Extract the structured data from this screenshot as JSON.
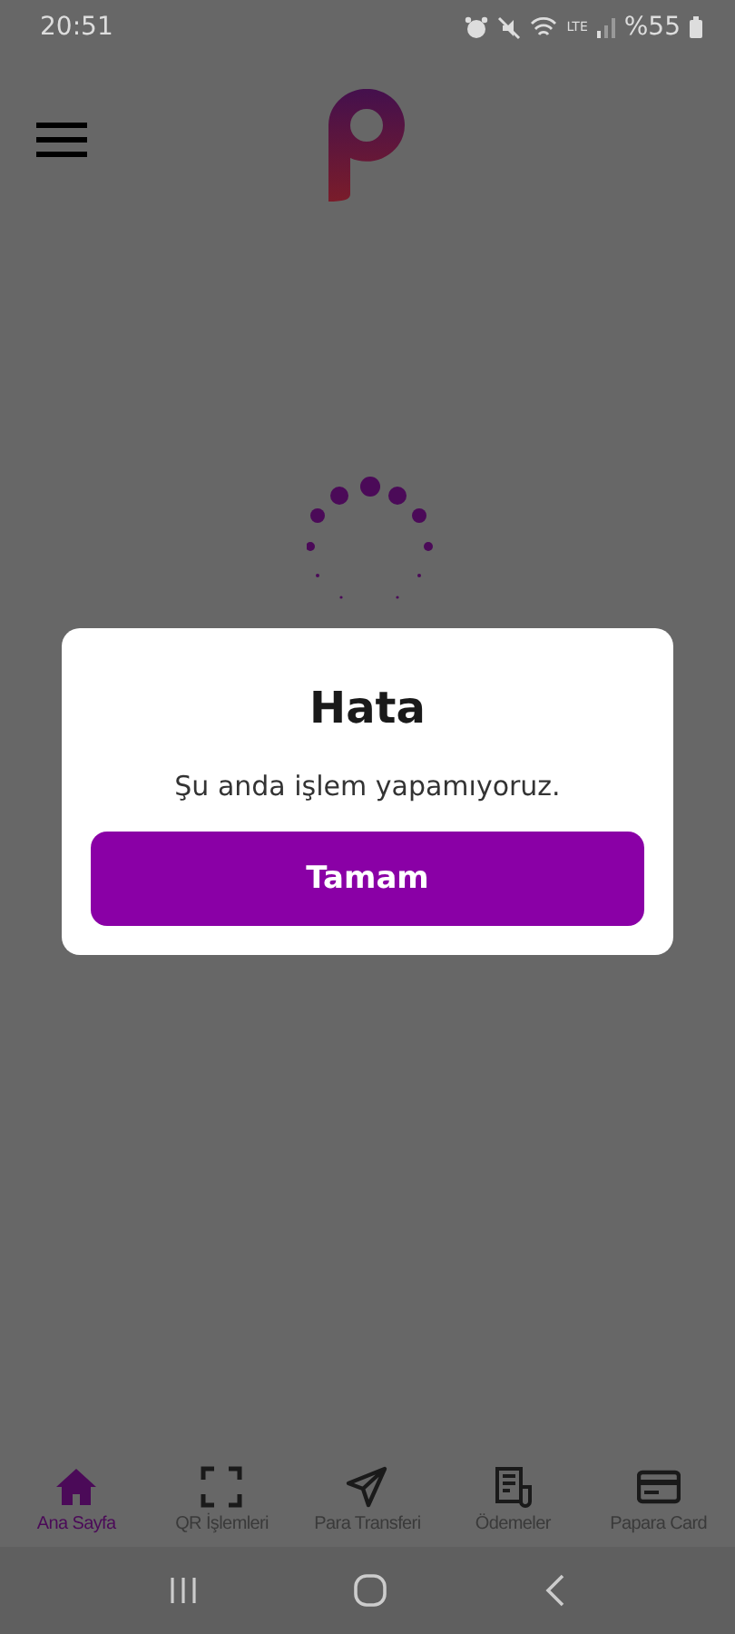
{
  "status_bar": {
    "time": "20:51",
    "network": "LTE",
    "battery": "%55"
  },
  "dialog": {
    "title": "Hata",
    "message": "Şu anda işlem yapamıyoruz.",
    "button": "Tamam"
  },
  "bottom_nav": [
    {
      "label": "Ana Sayfa",
      "kind": "home",
      "selected": true
    },
    {
      "label": "QR İşlemleri",
      "kind": "scan",
      "selected": false
    },
    {
      "label": "Para Transferi",
      "kind": "send",
      "selected": false
    },
    {
      "label": "Ödemeler",
      "kind": "bill",
      "selected": false
    },
    {
      "label": "Papara Card",
      "kind": "card",
      "selected": false
    }
  ]
}
